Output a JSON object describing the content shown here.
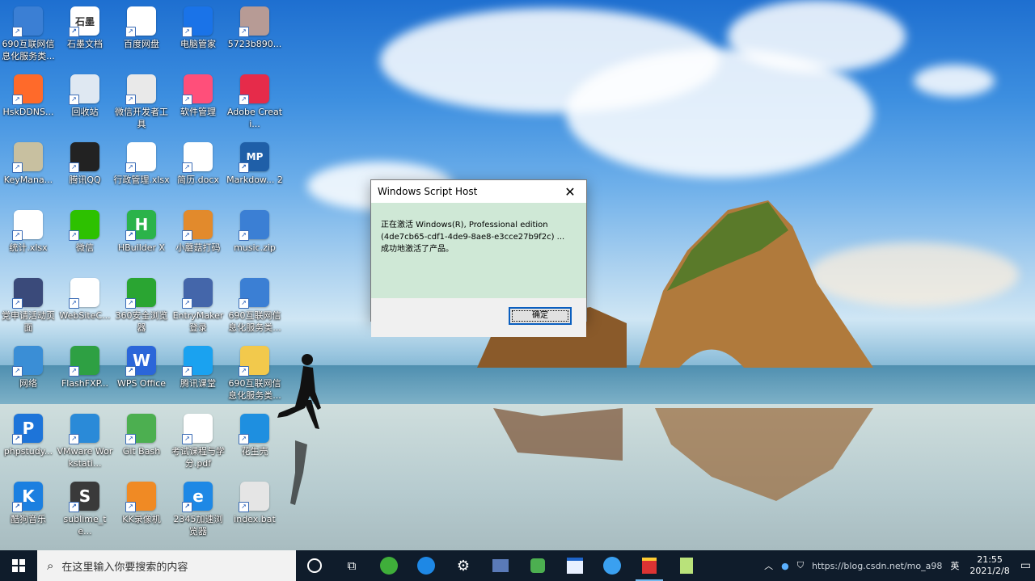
{
  "desktop_icons": [
    {
      "label": "690互联网信息化服务类...",
      "icon": "winrar-icon",
      "color": "#3b7fd4"
    },
    {
      "label": "石墨文档",
      "icon": "shimo-icon",
      "color": "#ffffff",
      "glyph": "石墨"
    },
    {
      "label": "百度网盘",
      "icon": "baidu-netdisk-icon",
      "color": "#ffffff"
    },
    {
      "label": "电脑管家",
      "icon": "pc-manager-icon",
      "color": "#1a73e8"
    },
    {
      "label": "5723b890...",
      "icon": "image-file-icon",
      "color": "#b79b95"
    },
    {
      "label": "HskDDNS...",
      "icon": "hsk-ddns-icon",
      "color": "#ff6a2a"
    },
    {
      "label": "回收站",
      "icon": "recycle-bin-icon",
      "color": "#dfe8f2"
    },
    {
      "label": "微信开发者工具",
      "icon": "wechat-devtools-icon",
      "color": "#e9e9e9"
    },
    {
      "label": "软件管理",
      "icon": "software-manager-icon",
      "color": "#ff4f7a"
    },
    {
      "label": "Adobe Creati...",
      "icon": "adobe-cc-icon",
      "color": "#e62b4a"
    },
    {
      "label": "KeyMana...",
      "icon": "keymanager-icon",
      "color": "#c8c0a0"
    },
    {
      "label": "腾讯QQ",
      "icon": "qq-icon",
      "color": "#222222"
    },
    {
      "label": "行政管理.xlsx",
      "icon": "xlsx-file-icon",
      "color": "#ffffff"
    },
    {
      "label": "简历.docx",
      "icon": "docx-file-icon",
      "color": "#ffffff"
    },
    {
      "label": "Markdow... 2",
      "icon": "markdownpad-icon",
      "color": "#1f5fa8",
      "glyph": "MP"
    },
    {
      "label": "统计.xlsx",
      "icon": "xlsx-file-icon",
      "color": "#ffffff"
    },
    {
      "label": "微信",
      "icon": "wechat-icon",
      "color": "#2dc100"
    },
    {
      "label": "HBuilder X",
      "icon": "hbuilderx-icon",
      "color": "#2bb34a",
      "glyph": "H"
    },
    {
      "label": "小蘑菇打码",
      "icon": "mushroom-icon",
      "color": "#e28a2c"
    },
    {
      "label": "music.zip",
      "icon": "winrar-icon",
      "color": "#3b7fd4"
    },
    {
      "label": "党申请活动页面",
      "icon": "folder-book-icon",
      "color": "#3a4a7a"
    },
    {
      "label": "WebSiteC...",
      "icon": "butterfly-icon",
      "color": "#ffffff"
    },
    {
      "label": "360安全浏览器",
      "icon": "360-browser-icon",
      "color": "#2aa532"
    },
    {
      "label": "EntryMaker登录",
      "icon": "entrymaker-icon",
      "color": "#4466aa"
    },
    {
      "label": "690互联网信息化服务类...",
      "icon": "winrar-icon",
      "color": "#3b7fd4"
    },
    {
      "label": "网络",
      "icon": "network-icon",
      "color": "#3a8ed6"
    },
    {
      "label": "FlashFXP...",
      "icon": "flashfxp-icon",
      "color": "#2ea043"
    },
    {
      "label": "WPS Office",
      "icon": "wps-icon",
      "color": "#2b66d9",
      "glyph": "W"
    },
    {
      "label": "腾讯课堂",
      "icon": "tencent-class-icon",
      "color": "#1aa2f0"
    },
    {
      "label": "690互联网信息化服务类...",
      "icon": "folder-icon",
      "color": "#f2c94c"
    },
    {
      "label": "phpstudy...",
      "icon": "phpstudy-icon",
      "color": "#1d74d9",
      "glyph": "P"
    },
    {
      "label": "VMware Workstati...",
      "icon": "vmware-icon",
      "color": "#2a8ad8"
    },
    {
      "label": "Git Bash",
      "icon": "git-bash-icon",
      "color": "#4caf50"
    },
    {
      "label": "考试课程与学分.pdf",
      "icon": "pdf-file-icon",
      "color": "#ffffff"
    },
    {
      "label": "花生壳",
      "icon": "peanut-shell-icon",
      "color": "#1e8fe0"
    },
    {
      "label": "酷狗音乐",
      "icon": "kugou-icon",
      "color": "#1b7fe0",
      "glyph": "K"
    },
    {
      "label": "sublime_te...",
      "icon": "sublime-icon",
      "color": "#3a3a3a",
      "glyph": "S"
    },
    {
      "label": "KK录像机",
      "icon": "kk-recorder-icon",
      "color": "#f08a24"
    },
    {
      "label": "2345加速浏览器",
      "icon": "2345-browser-icon",
      "color": "#1e88e5",
      "glyph": "e"
    },
    {
      "label": "index.bat",
      "icon": "bat-file-icon",
      "color": "#e5e5e5"
    }
  ],
  "dialog": {
    "title": "Windows Script Host",
    "line1": "正在激活 Windows(R), Professional edition",
    "line2": "(4de7cb65-cdf1-4de9-8ae8-e3cce27b9f2c) ...",
    "line3": "成功地激活了产品。",
    "ok_label": "确定"
  },
  "taskbar": {
    "search_placeholder": "在这里输入你要搜索的内容",
    "ime_label": "英",
    "time": "21:55",
    "date": "2021/2/8",
    "watermark": "https://blog.csdn.net/mo_a98"
  }
}
